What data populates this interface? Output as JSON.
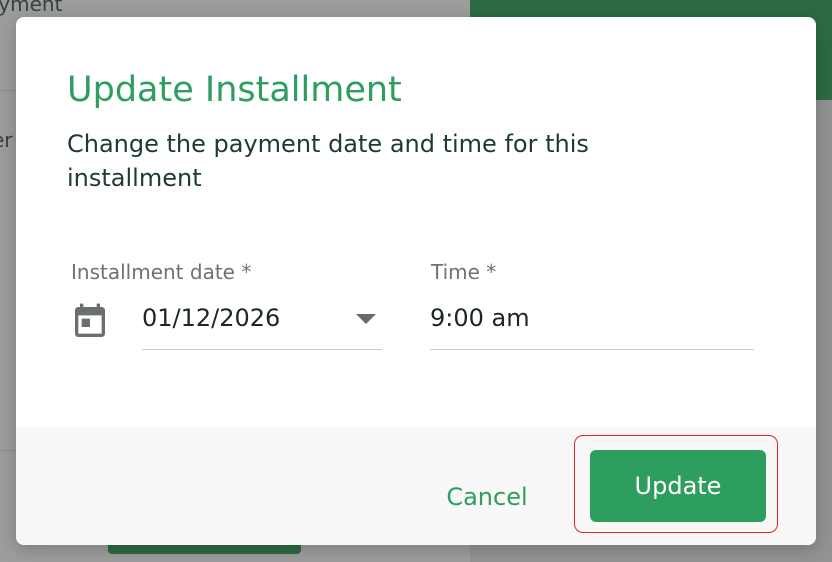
{
  "background": {
    "top_text": "ayment",
    "mid_text": "er"
  },
  "dialog": {
    "title": "Update Installment",
    "subtitle": "Change the payment date and time for this installment",
    "date_field": {
      "label": "Installment date *",
      "value": "01/12/2026",
      "icon": "calendar-icon"
    },
    "time_field": {
      "label": "Time *",
      "value": "9:00 am"
    },
    "buttons": {
      "cancel_label": "Cancel",
      "update_label": "Update"
    }
  },
  "colors": {
    "accent": "#2e9e5f",
    "highlight": "#e02626"
  }
}
